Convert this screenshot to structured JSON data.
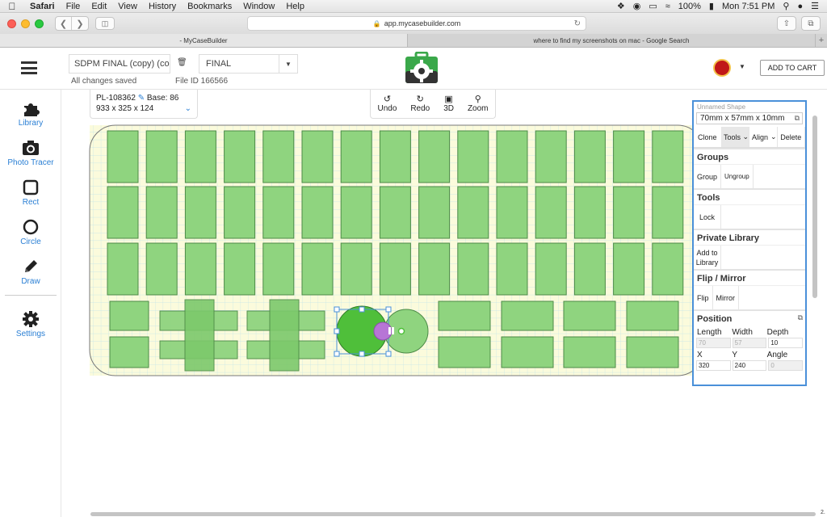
{
  "menubar": {
    "app": "Safari",
    "items": [
      "File",
      "Edit",
      "View",
      "History",
      "Bookmarks",
      "Window",
      "Help"
    ],
    "battery": "100%",
    "clock": "Mon 7:51 PM"
  },
  "browser": {
    "url": "app.mycasebuilder.com",
    "tabs": [
      {
        "label": "- MyCaseBuilder",
        "active": true
      },
      {
        "label": "where to find my screenshots on mac - Google Search",
        "active": false
      }
    ]
  },
  "header": {
    "project_name": "SDPM FINAL (copy) (cop",
    "case_select": "FINAL",
    "save_status": "All changes saved",
    "file_id": "File ID 166566",
    "cart_label": "ADD TO CART"
  },
  "sidebar": {
    "items": [
      {
        "label": "Library",
        "icon": "puzzle-icon"
      },
      {
        "label": "Photo Tracer",
        "icon": "camera-icon"
      },
      {
        "label": "Rect",
        "icon": "square-icon"
      },
      {
        "label": "Circle",
        "icon": "circle-icon"
      },
      {
        "label": "Draw",
        "icon": "pencil-icon"
      },
      {
        "label": "Settings",
        "icon": "gear-icon"
      }
    ]
  },
  "case_info": {
    "part": "PL-108362",
    "base": "Base: 86",
    "dims": "933 x 325 x 124"
  },
  "edit_tools": {
    "undo": "Undo",
    "redo": "Redo",
    "view3d": "3D",
    "zoom": "Zoom"
  },
  "props": {
    "title": "Unnamed Shape",
    "dims": "70mm x 57mm x 10mm",
    "actions": {
      "clone": "Clone",
      "tools": "Tools",
      "align": "Align",
      "delete": "Delete"
    },
    "groups": {
      "title": "Groups",
      "group": "Group",
      "ungroup": "Ungroup"
    },
    "tools": {
      "title": "Tools",
      "lock": "Lock"
    },
    "private_library": {
      "title": "Private Library",
      "add": "Add to Library"
    },
    "flip_mirror": {
      "title": "Flip / Mirror",
      "flip": "Flip",
      "mirror": "Mirror"
    },
    "position": {
      "title": "Position",
      "length_label": "Length",
      "width_label": "Width",
      "depth_label": "Depth",
      "length": "70",
      "width": "57",
      "depth": "10",
      "x_label": "X",
      "y_label": "Y",
      "angle_label": "Angle",
      "x": "320",
      "y": "240",
      "angle": "0"
    }
  },
  "colors": {
    "accent": "#2a7fd4",
    "cutout_fill": "#8fd47f",
    "cutout_selected": "#4fbf3a",
    "foam": "#fbfbdc",
    "grid": "#bfe3ea",
    "selection": "#4a90d9"
  },
  "corner_text": "2."
}
